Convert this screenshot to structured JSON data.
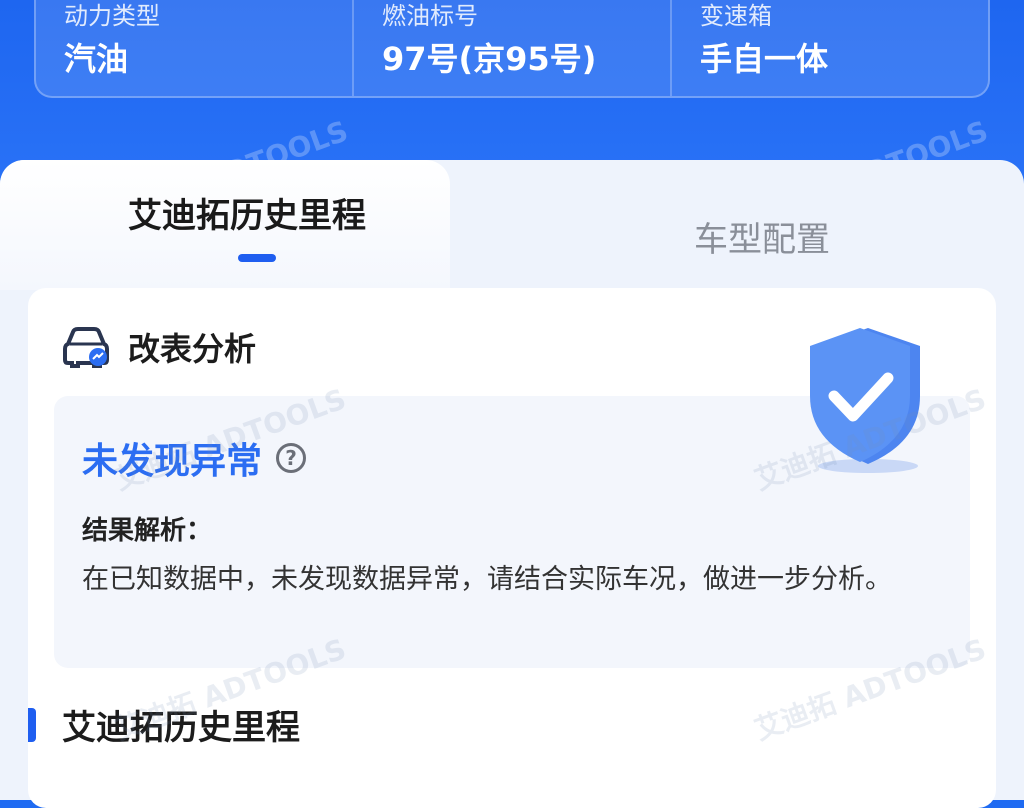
{
  "specs": [
    {
      "label": "动力类型",
      "value": "汽油"
    },
    {
      "label": "燃油标号",
      "value": "97号(京95号)"
    },
    {
      "label": "变速箱",
      "value": "手自一体"
    }
  ],
  "tabs": {
    "active": "艾迪拓历史里程",
    "inactive": "车型配置"
  },
  "section": {
    "title": "改表分析",
    "status": "未发现异常",
    "help_icon": "?",
    "analysis_label": "结果解析：",
    "analysis_text": "在已知数据中，未发现数据异常，请结合实际车况，做进一步分析。"
  },
  "history": {
    "title": "艾迪拓历史里程"
  },
  "watermark": "艾迪拓 ADTOOLS",
  "colors": {
    "brand_blue": "#1f66f0",
    "status_blue": "#2b6df2"
  }
}
